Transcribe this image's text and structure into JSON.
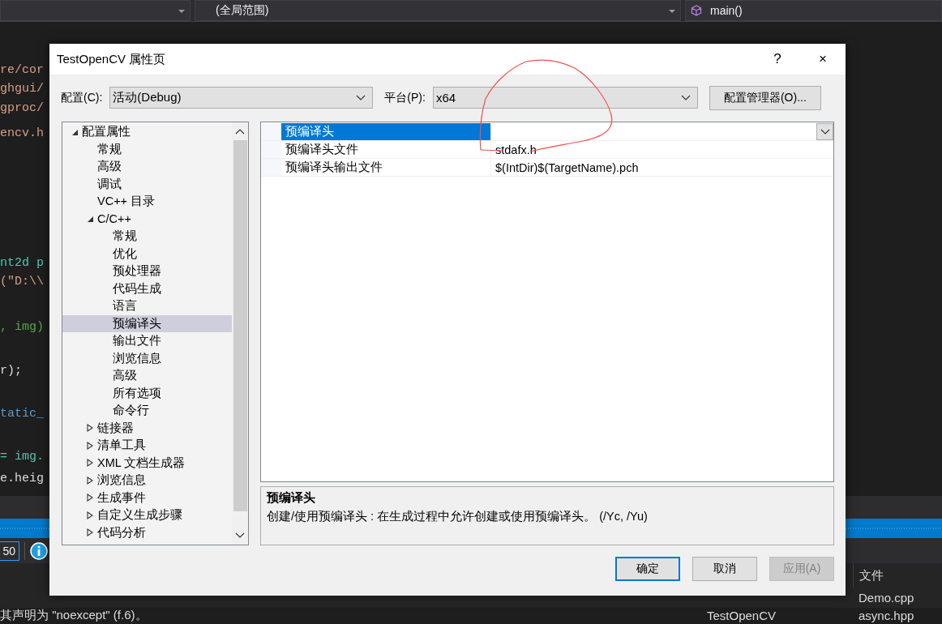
{
  "ide": {
    "combos": [
      {
        "kind": "plain"
      },
      {
        "text": "(全局范围)",
        "kind": "plain"
      },
      {
        "text": "main()",
        "kind": "member"
      }
    ],
    "code_lines": [
      {
        "text": "re/cor",
        "color": "#d69d85"
      },
      {
        "text": "ghgui/",
        "color": "#d69d85"
      },
      {
        "text": "gproc/",
        "color": "#d69d85"
      },
      {
        "text": "encv.h",
        "color": "#d69d85"
      },
      {
        "text": "nt2d p",
        "color": "#4ec9b0"
      },
      {
        "text": "(\"D:\\\\",
        "color": "#d69d85"
      },
      {
        "text": ", img)",
        "color": "#57a64a"
      },
      {
        "text": "r);",
        "color": "#dcdcdc"
      },
      {
        "text": "tatic_",
        "color": "#569cd6"
      },
      {
        "text": "= img.",
        "color": "#4ec9b0"
      },
      {
        "text": "e.heig",
        "color": "#dcdcdc"
      }
    ],
    "zoom_field": {
      "value": "50"
    },
    "list_header": "文件",
    "list_rows": [
      {
        "project": "",
        "file": "Demo.cpp"
      },
      {
        "project": "TestOpenCV",
        "file": "async.hpp"
      }
    ],
    "status_text": "其声明为 \"noexcept\" (f.6)。"
  },
  "dialog": {
    "title": "TestOpenCV 属性页",
    "help": "?",
    "close": "×",
    "config_label": "配置(C):",
    "config_value": "活动(Debug)",
    "platform_label": "平台(P):",
    "platform_value": "x64",
    "manager_button": "配置管理器(O)...",
    "tree": [
      {
        "label": "配置属性",
        "expanded": true,
        "selected": false,
        "children": [
          {
            "label": "常规",
            "selected": false
          },
          {
            "label": "高级",
            "selected": false
          },
          {
            "label": "调试",
            "selected": false
          },
          {
            "label": "VC++ 目录",
            "selected": false
          },
          {
            "label": "C/C++",
            "expanded": true,
            "selected": false,
            "children": [
              {
                "label": "常规",
                "selected": false
              },
              {
                "label": "优化",
                "selected": false
              },
              {
                "label": "预处理器",
                "selected": false
              },
              {
                "label": "代码生成",
                "selected": false
              },
              {
                "label": "语言",
                "selected": false
              },
              {
                "label": "预编译头",
                "selected": true
              },
              {
                "label": "输出文件",
                "selected": false
              },
              {
                "label": "浏览信息",
                "selected": false
              },
              {
                "label": "高级",
                "selected": false
              },
              {
                "label": "所有选项",
                "selected": false
              },
              {
                "label": "命令行",
                "selected": false
              }
            ]
          },
          {
            "label": "链接器",
            "expanded": false,
            "selected": false
          },
          {
            "label": "清单工具",
            "expanded": false,
            "selected": false
          },
          {
            "label": "XML 文档生成器",
            "expanded": false,
            "selected": false
          },
          {
            "label": "浏览信息",
            "expanded": false,
            "selected": false
          },
          {
            "label": "生成事件",
            "expanded": false,
            "selected": false
          },
          {
            "label": "自定义生成步骤",
            "expanded": false,
            "selected": false
          },
          {
            "label": "代码分析",
            "expanded": false,
            "selected": false
          }
        ]
      }
    ],
    "properties": [
      {
        "name": "预编译头",
        "selected": true
      },
      {
        "name": "预编译头文件",
        "value": "stdafx.h",
        "selected": false
      },
      {
        "name": "预编译头输出文件",
        "value": "$(IntDir)$(TargetName).pch",
        "selected": false
      }
    ],
    "description": {
      "title": "预编译头",
      "text": "创建/使用预编译头 : 在生成过程中允许创建或使用预编译头。     (/Yc, /Yu)"
    },
    "buttons": [
      {
        "label": "确定",
        "kind": "default",
        "disabled": false
      },
      {
        "label": "取消",
        "kind": "normal",
        "disabled": false
      },
      {
        "label": "应用(A)",
        "kind": "normal",
        "disabled": true
      }
    ]
  }
}
